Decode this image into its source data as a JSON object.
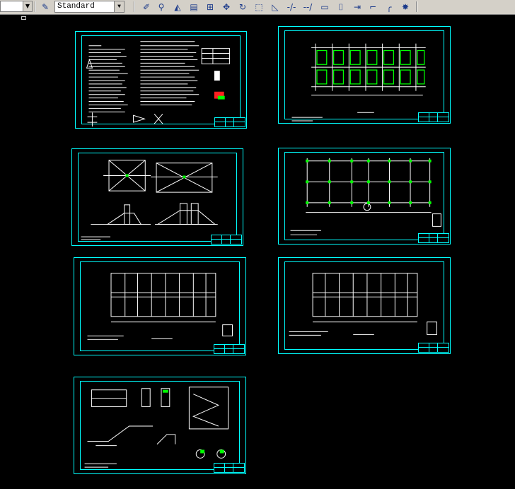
{
  "toolbar": {
    "text_style_value": "Standard",
    "icons": [
      "text-style-icon",
      "edit-icon",
      "find-icon",
      "dim-style-icon",
      "align-icon",
      "array-icon",
      "move-icon",
      "rotate-icon",
      "scale-icon",
      "stretch-icon",
      "trim-icon",
      "extend-icon",
      "rectangle-icon",
      "break-icon",
      "join-icon",
      "chamfer-icon",
      "fillet-icon",
      "explode-icon"
    ]
  },
  "colors": {
    "background": "#000000",
    "sheet_border": "#00ffff",
    "drawing_lines": "#ffffff",
    "columns": "#00ff00",
    "toolbar": "#d4d0c8"
  },
  "sheets": [
    {
      "id": "sheet-general-notes",
      "kind": "notes"
    },
    {
      "id": "sheet-column-plan",
      "kind": "grid-plan"
    },
    {
      "id": "sheet-foundation-details",
      "kind": "details"
    },
    {
      "id": "sheet-beam-plan",
      "kind": "grid-plan"
    },
    {
      "id": "sheet-floor-plan-1",
      "kind": "floor-plan"
    },
    {
      "id": "sheet-floor-plan-2",
      "kind": "floor-plan"
    },
    {
      "id": "sheet-stair-details",
      "kind": "details"
    }
  ]
}
